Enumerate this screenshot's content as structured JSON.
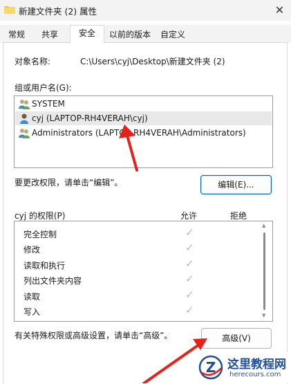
{
  "window": {
    "title": "新建文件夹 (2) 属性",
    "close_glyph": "✕"
  },
  "tabs": [
    {
      "label": "常规"
    },
    {
      "label": "共享"
    },
    {
      "label": "安全",
      "active": true
    },
    {
      "label": "以前的版本"
    },
    {
      "label": "自定义"
    }
  ],
  "security": {
    "object_name_label": "对象名称:",
    "object_name_value": "C:\\Users\\cyj\\Desktop\\新建文件夹 (2)",
    "group_label": "组或用户名(G):",
    "users": [
      {
        "name": "SYSTEM",
        "icon": "user-group-icon"
      },
      {
        "name": "cyj (LAPTOP-RH4VERAH\\cyj)",
        "icon": "user-icon",
        "selected": true
      },
      {
        "name": "Administrators (LAPTOP-RH4VERAH\\Administrators)",
        "icon": "user-group-icon"
      }
    ],
    "edit_hint": "要更改权限，请单击“编辑”。",
    "edit_button": "编辑(E)...",
    "permissions_label": "cyj 的权限(P)",
    "allow_header": "允许",
    "deny_header": "拒绝",
    "permissions": [
      {
        "name": "完全控制",
        "allow": true,
        "deny": false
      },
      {
        "name": "修改",
        "allow": true,
        "deny": false
      },
      {
        "name": "读取和执行",
        "allow": true,
        "deny": false
      },
      {
        "name": "列出文件夹内容",
        "allow": true,
        "deny": false
      },
      {
        "name": "读取",
        "allow": true,
        "deny": false
      },
      {
        "name": "写入",
        "allow": true,
        "deny": false
      }
    ],
    "check_glyph": "✓",
    "advanced_hint": "有关特殊权限或高级设置，请单击“高级”。",
    "advanced_button": "高级(V)"
  },
  "annotation": {
    "arrow_color": "#e8201a"
  },
  "watermark": {
    "logo_letter": "Z",
    "site_name": "这里教程网",
    "domain": "herecours.com",
    "color": "#1f4e9e"
  }
}
